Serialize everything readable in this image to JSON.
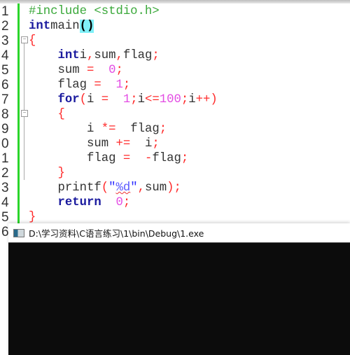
{
  "editor": {
    "line_numbers": [
      "1",
      "2",
      "3",
      "4",
      "5",
      "6",
      "7",
      "8",
      "9",
      "0",
      "1",
      "2",
      "3",
      "4",
      "5",
      "6"
    ],
    "lines": [
      [
        [
          "pp",
          "#include <stdio.h>"
        ]
      ],
      [
        [
          "kw",
          "int"
        ],
        [
          "",
          "main"
        ],
        [
          "hl",
          "()"
        ]
      ],
      [
        [
          "op",
          "{"
        ]
      ],
      [
        [
          "",
          "    "
        ],
        [
          "kw",
          "int"
        ],
        [
          "",
          "i"
        ],
        [
          "op",
          ","
        ],
        [
          "",
          "sum"
        ],
        [
          "op",
          ","
        ],
        [
          "",
          "flag"
        ],
        [
          "op",
          ";"
        ]
      ],
      [
        [
          "",
          "    sum "
        ],
        [
          "op",
          "="
        ],
        [
          "",
          "  "
        ],
        [
          "num",
          "0"
        ],
        [
          "op",
          ";"
        ]
      ],
      [
        [
          "",
          "    flag "
        ],
        [
          "op",
          "="
        ],
        [
          "",
          "  "
        ],
        [
          "num",
          "1"
        ],
        [
          "op",
          ";"
        ]
      ],
      [
        [
          "",
          "    "
        ],
        [
          "kw",
          "for"
        ],
        [
          "op",
          "("
        ],
        [
          "",
          "i "
        ],
        [
          "op",
          "="
        ],
        [
          "",
          "  "
        ],
        [
          "num",
          "1"
        ],
        [
          "op",
          ";"
        ],
        [
          "",
          "i"
        ],
        [
          "op",
          "<="
        ],
        [
          "num",
          "100"
        ],
        [
          "op",
          ";"
        ],
        [
          "",
          "i"
        ],
        [
          "op",
          "++)"
        ]
      ],
      [
        [
          "",
          "    "
        ],
        [
          "op",
          "{"
        ]
      ],
      [
        [
          "",
          "        i "
        ],
        [
          "op",
          "*="
        ],
        [
          "",
          "  flag"
        ],
        [
          "op",
          ";"
        ]
      ],
      [
        [
          "",
          "        sum "
        ],
        [
          "op",
          "+="
        ],
        [
          "",
          "  i"
        ],
        [
          "op",
          ";"
        ]
      ],
      [
        [
          "",
          "        flag "
        ],
        [
          "op",
          "="
        ],
        [
          "",
          "  "
        ],
        [
          "op",
          "-"
        ],
        [
          "",
          "flag"
        ],
        [
          "op",
          ";"
        ]
      ],
      [
        [
          "",
          "    "
        ],
        [
          "op",
          "}"
        ]
      ],
      [
        [
          "",
          "    printf"
        ],
        [
          "op",
          "("
        ],
        [
          "str",
          "\""
        ],
        [
          "fmt",
          "%d"
        ],
        [
          "str",
          "\""
        ],
        [
          "op",
          ","
        ],
        [
          "",
          "sum"
        ],
        [
          "op",
          ");"
        ]
      ],
      [
        [
          "",
          "    "
        ],
        [
          "kw",
          "return"
        ],
        [
          "",
          "  "
        ],
        [
          "num",
          "0"
        ],
        [
          "op",
          ";"
        ]
      ],
      [
        [
          "op",
          "}"
        ]
      ]
    ]
  },
  "console": {
    "title": "D:\\学习资料\\C语言练习\\1\\bin\\Debug\\1.exe",
    "icon": "console-app-icon",
    "background": "#0c0c0c"
  },
  "colors": {
    "change_bar": "#2bd52b",
    "keyword": "#1a1a9e",
    "preprocessor": "#3aa83a",
    "operator": "#ff2a2a",
    "number": "#e34ce3",
    "string": "#2b2bff"
  }
}
